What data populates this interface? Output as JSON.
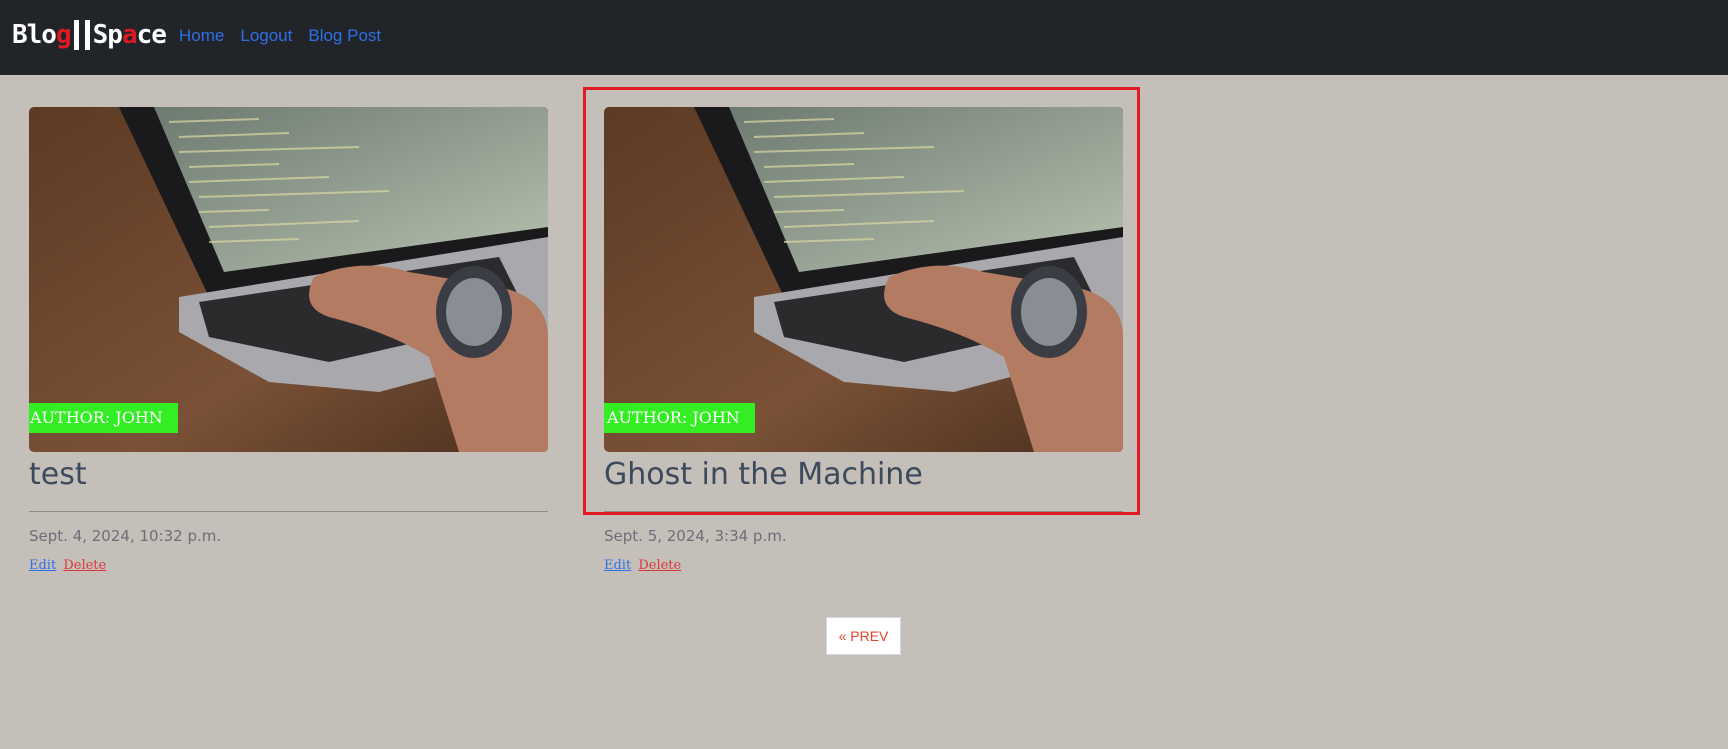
{
  "brand": {
    "part1": "Blo",
    "part1_red": "g",
    "part2": "Sp",
    "part2_red": "a",
    "part3": "ce"
  },
  "nav": {
    "home": "Home",
    "logout": "Logout",
    "blog_post": "Blog Post"
  },
  "posts": [
    {
      "author": "AUTHOR: JOHN",
      "title": "test",
      "date": "Sept. 4, 2024, 10:32 p.m.",
      "edit": "Edit",
      "delete": "Delete"
    },
    {
      "author": "AUTHOR: JOHN",
      "title": "Ghost in the Machine",
      "date": "Sept. 5, 2024, 3:34 p.m.",
      "edit": "Edit",
      "delete": "Delete"
    }
  ],
  "pagination": {
    "prev": "« PREV"
  },
  "colors": {
    "navbar": "#212529",
    "background": "#c4bfb9",
    "link": "#2f6fe8",
    "badge": "#33ee22",
    "highlight": "#e21b22",
    "delete": "#d9383e"
  }
}
